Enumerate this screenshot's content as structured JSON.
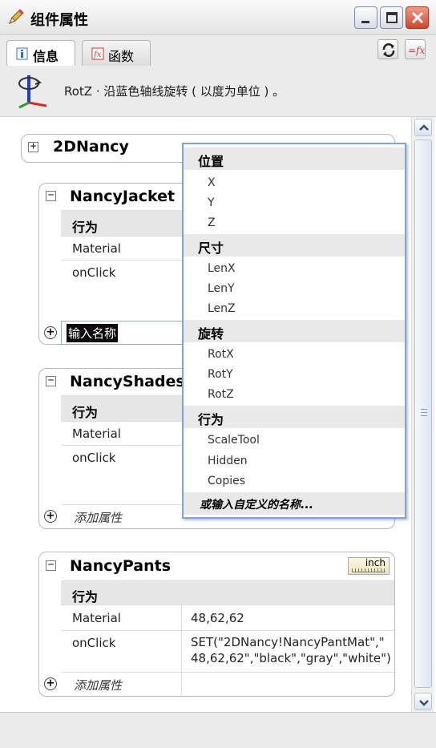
{
  "window": {
    "title": "组件属性"
  },
  "tabs": [
    {
      "label": "信息"
    },
    {
      "label": "函数"
    }
  ],
  "info": {
    "text": "RotZ · 沿蓝色轴线旋转 ( 以度为单位 ) 。"
  },
  "components": [
    {
      "name": "2DNancy"
    },
    {
      "name": "NancyJacket",
      "behavior_label": "行为",
      "rows": [
        {
          "name": "Material",
          "value": ""
        },
        {
          "name": "onClick",
          "value": ""
        }
      ],
      "name_input": "输入名称"
    },
    {
      "name": "NancyShades",
      "behavior_label": "行为",
      "rows": [
        {
          "name": "Material",
          "value": ""
        },
        {
          "name": "onClick",
          "value": ""
        }
      ],
      "add_label": "添加属性"
    },
    {
      "name": "NancyPants",
      "unit": "inch",
      "behavior_label": "行为",
      "rows": [
        {
          "name": "Material",
          "value": "48,62,62"
        },
        {
          "name": "onClick",
          "value_line1": "SET(\"2DNancy!NancyPantMat\",\"",
          "value_line2": "48,62,62\",\"black\",\"gray\",\"white\")"
        }
      ],
      "add_label": "添加属性"
    }
  ],
  "dropdown": {
    "sections": [
      {
        "header": "位置",
        "items": [
          "X",
          "Y",
          "Z"
        ]
      },
      {
        "header": "尺寸",
        "items": [
          "LenX",
          "LenY",
          "LenZ"
        ]
      },
      {
        "header": "旋转",
        "items": [
          "RotX",
          "RotY",
          "RotZ"
        ]
      },
      {
        "header": "行为",
        "items": [
          "ScaleTool",
          "Hidden",
          "Copies"
        ]
      }
    ],
    "custom": "或输入自定义的名称..."
  },
  "colors": {
    "dropdown_border": "#7fa3dc",
    "close_button": "#d0472d",
    "behavior_header": "#e6e6e6"
  }
}
